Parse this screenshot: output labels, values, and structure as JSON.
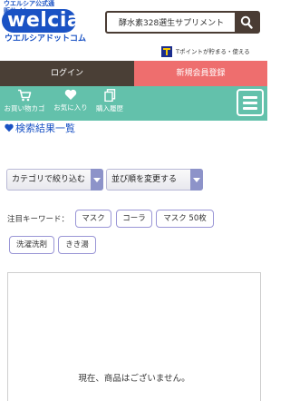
{
  "header": {
    "logo_tagline": "ウエルシア公式通販サイト",
    "logo_brand": "welcia",
    "logo_subtitle": "ウエルシアドットコム",
    "search_value": "酵水素328選生サプリメント",
    "tpoint_text": "Tポイントが貯まる・使える"
  },
  "auth": {
    "login_label": "ログイン",
    "register_label": "新規会員登録"
  },
  "nav": {
    "items": [
      {
        "label": "お買い物カゴ",
        "icon": "cart-icon"
      },
      {
        "label": "お気に入り",
        "icon": "heart-icon"
      },
      {
        "label": "購入履歴",
        "icon": "history-icon"
      }
    ],
    "menu_icon": "hamburger-icon"
  },
  "results": {
    "title": "検索結果一覧"
  },
  "filters": {
    "category_label": "カテゴリで絞り込む",
    "sort_label": "並び順を変更する"
  },
  "keywords": {
    "label": "注目キーワード：",
    "items": [
      "マスク",
      "コーラ",
      "マスク 50枚",
      "洗濯洗剤",
      "きき湯"
    ]
  },
  "empty": {
    "message": "現在、商品はございません。"
  },
  "colors": {
    "brand_blue": "#1a52c4",
    "dark_brown": "#4a3f36",
    "register_pink": "#ee6e6e",
    "nav_teal": "#63c1ab",
    "dropdown_arrow": "#8d93c9"
  }
}
